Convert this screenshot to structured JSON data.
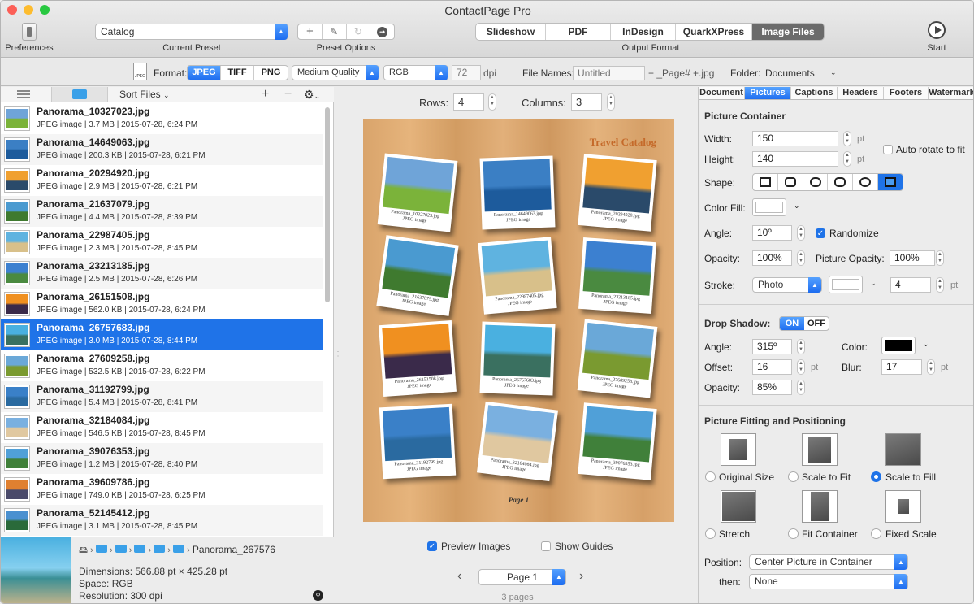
{
  "window": {
    "title": "ContactPage Pro"
  },
  "toolbar": {
    "preferences_label": "Preferences",
    "preset_value": "Catalog",
    "current_preset_label": "Current Preset",
    "preset_options_label": "Preset Options",
    "output_tabs": [
      "Slideshow",
      "PDF",
      "InDesign",
      "QuarkXPress",
      "Image Files"
    ],
    "output_selected": "Image Files",
    "output_format_label": "Output Format",
    "start_label": "Start"
  },
  "format_bar": {
    "format_label": "Format:",
    "formats": [
      "JPEG",
      "TIFF",
      "PNG"
    ],
    "format_selected": "JPEG",
    "quality": "Medium Quality",
    "color_mode": "RGB",
    "dpi_value": "72",
    "dpi_unit": "dpi",
    "file_names_label": "File Names:",
    "file_name_placeholder": "Untitled",
    "file_name_suffix": "+ _Page# +.jpg",
    "folder_label": "Folder:",
    "folder_value": "Documents"
  },
  "file_list": {
    "sort_label": "Sort Files",
    "items": [
      {
        "name": "Panorama_10327023.jpg",
        "meta": "JPEG image | 3.7 MB | 2015-07-28, 6:24 PM",
        "c1": "#6fa4d8",
        "c2": "#7bb33a"
      },
      {
        "name": "Panorama_14649063.jpg",
        "meta": "JPEG image | 200.3 KB | 2015-07-28, 6:21 PM",
        "c1": "#3b7fc4",
        "c2": "#1d5b9c"
      },
      {
        "name": "Panorama_20294920.jpg",
        "meta": "JPEG image | 2.9 MB | 2015-07-28, 6:21 PM",
        "c1": "#f0a030",
        "c2": "#2a4a6a"
      },
      {
        "name": "Panorama_21637079.jpg",
        "meta": "JPEG image | 4.4 MB | 2015-07-28, 8:39 PM",
        "c1": "#4a9ad0",
        "c2": "#3f7a2f"
      },
      {
        "name": "Panorama_22987405.jpg",
        "meta": "JPEG image | 2.3 MB | 2015-07-28, 8:45 PM",
        "c1": "#5fb3e0",
        "c2": "#d8c08a"
      },
      {
        "name": "Panorama_23213185.jpg",
        "meta": "JPEG image | 2.5 MB | 2015-07-28, 6:26 PM",
        "c1": "#3c80d0",
        "c2": "#4a8a40"
      },
      {
        "name": "Panorama_26151508.jpg",
        "meta": "JPEG image | 562.0 KB | 2015-07-28, 6:24 PM",
        "c1": "#f09020",
        "c2": "#3a2a4a"
      },
      {
        "name": "Panorama_26757683.jpg",
        "meta": "JPEG image | 3.0 MB | 2015-07-28, 8:44 PM",
        "c1": "#4ab0e0",
        "c2": "#3a7060"
      },
      {
        "name": "Panorama_27609258.jpg",
        "meta": "JPEG image | 532.5 KB | 2015-07-28, 6:22 PM",
        "c1": "#6aa8d8",
        "c2": "#7a9a30"
      },
      {
        "name": "Panorama_31192799.jpg",
        "meta": "JPEG image | 5.4 MB | 2015-07-28, 8:41 PM",
        "c1": "#3a80c8",
        "c2": "#2a6aa0"
      },
      {
        "name": "Panorama_32184084.jpg",
        "meta": "JPEG image | 546.5 KB | 2015-07-28, 8:45 PM",
        "c1": "#7ab0e0",
        "c2": "#e0c8a0"
      },
      {
        "name": "Panorama_39076353.jpg",
        "meta": "JPEG image | 1.2 MB | 2015-07-28, 8:40 PM",
        "c1": "#50a0d8",
        "c2": "#40803a"
      },
      {
        "name": "Panorama_39609786.jpg",
        "meta": "JPEG image | 749.0 KB | 2015-07-28, 6:25 PM",
        "c1": "#e08030",
        "c2": "#4a4a6a"
      },
      {
        "name": "Panorama_52145412.jpg",
        "meta": "JPEG image | 3.1 MB | 2015-07-28, 8:45 PM",
        "c1": "#4a90d0",
        "c2": "#2a6a3a"
      }
    ],
    "selected_index": 7
  },
  "info": {
    "path_file": "Panorama_267576",
    "dimensions": "Dimensions: 566.88 pt × 425.28 pt",
    "space": "Space: RGB",
    "resolution": "Resolution: 300 dpi"
  },
  "preview": {
    "rows_label": "Rows:",
    "rows_value": "4",
    "columns_label": "Columns:",
    "columns_value": "3",
    "catalog_title": "Travel Catalog",
    "page_label": "Page 1",
    "photos": [
      {
        "cap1": "Panorama_10327023.jpg",
        "cap2": "JPEG image",
        "c1": "#6fa4d8",
        "c2": "#7bb33a"
      },
      {
        "cap1": "Panorama_14649063.jpg",
        "cap2": "JPEG image",
        "c1": "#3b7fc4",
        "c2": "#1d5b9c"
      },
      {
        "cap1": "Panorama_20294920.jpg",
        "cap2": "JPEG image",
        "c1": "#f0a030",
        "c2": "#2a4a6a"
      },
      {
        "cap1": "Panorama_21637079.jpg",
        "cap2": "JPEG image",
        "c1": "#4a9ad0",
        "c2": "#3f7a2f"
      },
      {
        "cap1": "Panorama_22987405.jpg",
        "cap2": "JPEG image",
        "c1": "#5fb3e0",
        "c2": "#d8c08a"
      },
      {
        "cap1": "Panorama_23213185.jpg",
        "cap2": "JPEG image",
        "c1": "#3c80d0",
        "c2": "#4a8a40"
      },
      {
        "cap1": "Panorama_26151508.jpg",
        "cap2": "JPEG image",
        "c1": "#f09020",
        "c2": "#3a2a4a"
      },
      {
        "cap1": "Panorama_26757683.jpg",
        "cap2": "JPEG image",
        "c1": "#4ab0e0",
        "c2": "#3a7060"
      },
      {
        "cap1": "Panorama_27609258.jpg",
        "cap2": "JPEG image",
        "c1": "#6aa8d8",
        "c2": "#7a9a30"
      },
      {
        "cap1": "Panorama_31192799.jpg",
        "cap2": "JPEG image",
        "c1": "#3a80c8",
        "c2": "#2a6aa0"
      },
      {
        "cap1": "Panorama_32184084.jpg",
        "cap2": "JPEG image",
        "c1": "#7ab0e0",
        "c2": "#e0c8a0"
      },
      {
        "cap1": "Panorama_39076353.jpg",
        "cap2": "JPEG image",
        "c1": "#50a0d8",
        "c2": "#40803a"
      }
    ],
    "preview_images_label": "Preview Images",
    "show_guides_label": "Show Guides",
    "page_select": "Page 1",
    "pages_count": "3 pages"
  },
  "inspector": {
    "tabs": [
      "Document",
      "Pictures",
      "Captions",
      "Headers",
      "Footers",
      "Watermark"
    ],
    "tab_selected": "Pictures",
    "picture_container": "Picture Container",
    "width_label": "Width:",
    "width_value": "150",
    "height_label": "Height:",
    "height_value": "140",
    "unit_pt": "pt",
    "auto_rotate_label": "Auto rotate to fit",
    "shape_label": "Shape:",
    "color_fill_label": "Color Fill:",
    "angle_label": "Angle:",
    "angle_value": "10º",
    "randomize_label": "Randomize",
    "opacity_label": "Opacity:",
    "opacity_value": "100%",
    "picture_opacity_label": "Picture Opacity:",
    "picture_opacity_value": "100%",
    "stroke_label": "Stroke:",
    "stroke_type": "Photo",
    "stroke_value": "4",
    "drop_shadow_label": "Drop Shadow:",
    "on_label": "ON",
    "off_label": "OFF",
    "ds_angle_value": "315º",
    "color_label": "Color:",
    "offset_label": "Offset:",
    "offset_value": "16",
    "blur_label": "Blur:",
    "blur_value": "17",
    "ds_opacity_value": "85%",
    "fitting_title": "Picture Fitting and Positioning",
    "fit_options": [
      "Original Size",
      "Scale to Fit",
      "Scale to Fill",
      "Stretch",
      "Fit Container",
      "Fixed Scale"
    ],
    "fit_selected": "Scale to Fill",
    "position_label": "Position:",
    "position_value": "Center Picture in Container",
    "then_label": "then:",
    "then_value": "None"
  }
}
